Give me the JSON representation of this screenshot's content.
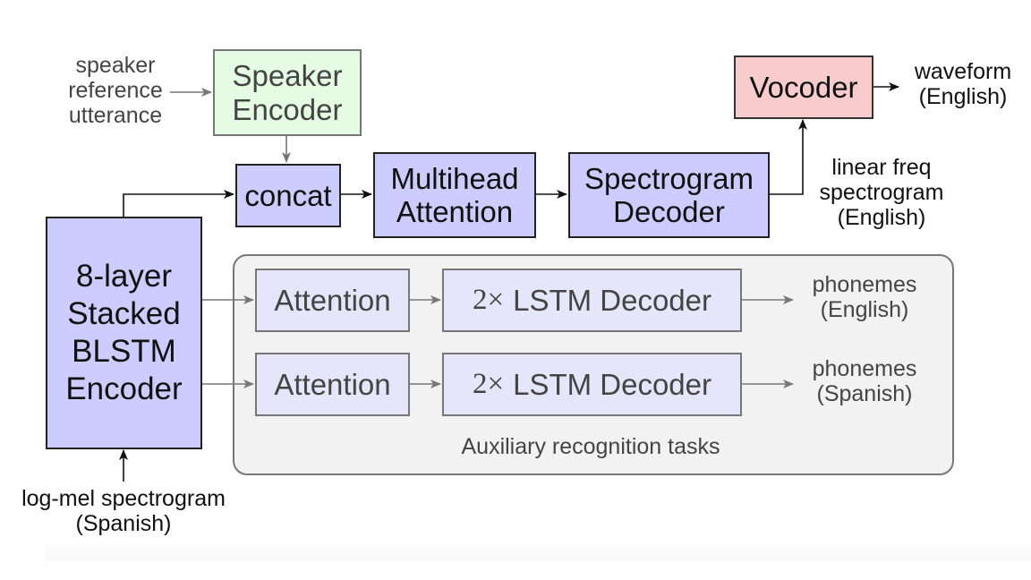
{
  "diagram": {
    "inputs": {
      "speaker_reference": [
        "speaker",
        "reference",
        "utterance"
      ],
      "log_mel": [
        "log-mel spectrogram",
        "(Spanish)"
      ]
    },
    "blocks": {
      "speaker_encoder": [
        "Speaker",
        "Encoder"
      ],
      "concat": "concat",
      "multihead_attention": [
        "Multihead",
        "Attention"
      ],
      "spectrogram_decoder": [
        "Spectrogram",
        "Decoder"
      ],
      "vocoder": "Vocoder",
      "blstm_encoder": [
        "8-layer",
        "Stacked",
        "BLSTM",
        "Encoder"
      ]
    },
    "outputs": {
      "waveform": [
        "waveform",
        "(English)"
      ],
      "linear_spectrogram": [
        "linear freq",
        "spectrogram",
        "(English)"
      ]
    },
    "auxiliary": {
      "title": "Auxiliary recognition tasks",
      "rows": [
        {
          "attention": "Attention",
          "decoder_prefix": "2×",
          "decoder": "LSTM Decoder",
          "output": [
            "phonemes",
            "(English)"
          ]
        },
        {
          "attention": "Attention",
          "decoder_prefix": "2×",
          "decoder": "LSTM Decoder",
          "output": [
            "phonemes",
            "(Spanish)"
          ]
        }
      ]
    },
    "colors": {
      "main_block": "#ccccff",
      "speaker_block": "#e6fbe4",
      "vocoder_block": "#f8cccc",
      "aux_block": "#e6e6fb",
      "aux_group": "#f2f2f2"
    }
  }
}
